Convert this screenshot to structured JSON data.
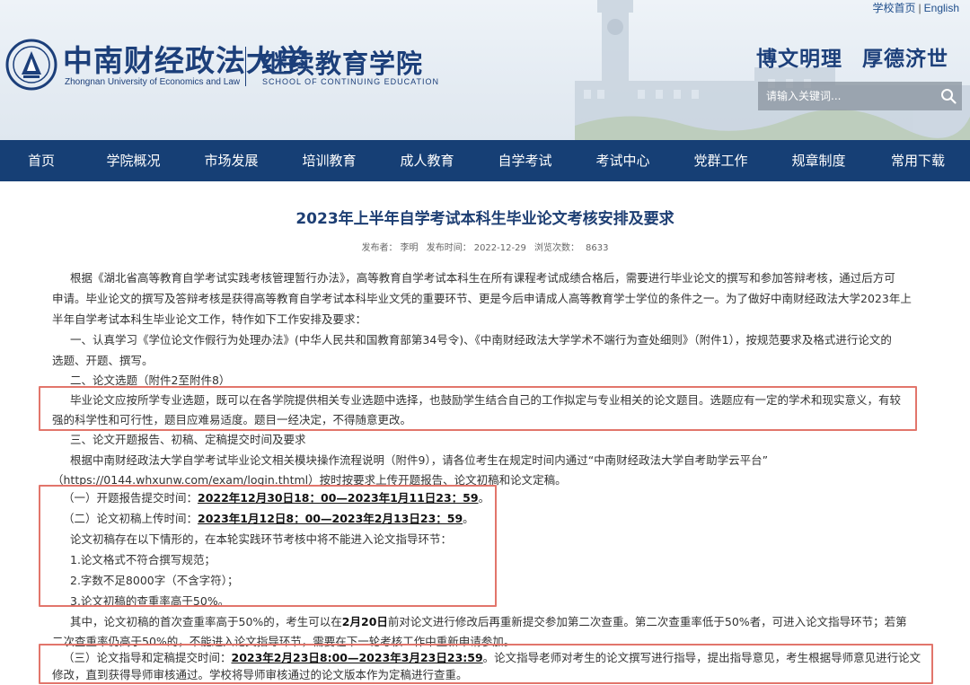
{
  "header": {
    "top_links": {
      "home": "学校首页",
      "separator": "|",
      "english": "English"
    },
    "university_cn": "中南财经政法大学",
    "university_en": "Zhongnan University of Economics and Law",
    "college_cn": "继续教育学院",
    "college_en": "SCHOOL OF CONTINUING EDUCATION",
    "motto_1": "博文明理",
    "motto_2": "厚德济世",
    "search": {
      "placeholder": "请输入关键词..."
    }
  },
  "nav": {
    "items": [
      {
        "label": "首页"
      },
      {
        "label": "学院概况"
      },
      {
        "label": "市场发展"
      },
      {
        "label": "培训教育"
      },
      {
        "label": "成人教育"
      },
      {
        "label": "自学考试"
      },
      {
        "label": "考试中心"
      },
      {
        "label": "党群工作"
      },
      {
        "label": "规章制度"
      },
      {
        "label": "常用下载"
      }
    ]
  },
  "article": {
    "title": "2023年上半年自学考试本科生毕业论文考核安排及要求",
    "meta": {
      "publisher_label": "发布者：",
      "publisher": "李明",
      "time_label": "发布时间：",
      "time": "2022-12-29",
      "views_label": "浏览次数：",
      "views": "8633"
    },
    "lines": {
      "p1_l1": "根据《湖北省高等教育自学考试实践考核管理暂行办法》，高等教育自学考试本科生在所有课程考试成绩合格后，需要进行毕业论文的撰写和参加答辩考核，通过后方可",
      "p1_l2": "申请。毕业论文的撰写及答辩考核是获得高等教育自学考试本科毕业文凭的重要环节、更是今后申请成人高等教育学士学位的条件之一。为了做好中南财经政法大学2023年上",
      "p1_l3": "半年自学考试本科生毕业论文工作，特作如下工作安排及要求：",
      "s1_l1": "一、认真学习《学位论文作假行为处理办法》(中华人民共和国教育部第34号令)、《中南财经政法大学学术不端行为查处细则》（附件1），按规范要求及格式进行论文的",
      "s1_l2": "选题、开题、撰写。",
      "s2_head": "二、论文选题（附件2至附件8）",
      "s2_l1": "毕业论文应按所学专业选题，既可以在各学院提供相关专业选题中选择，也鼓励学生结合自己的工作拟定与专业相关的论文题目。选题应有一定的学术和现实意义，有较",
      "s2_l2": "强的科学性和可行性，题目应难易适度。题目一经决定，不得随意更改。",
      "s3_head": "三、论文开题报告、初稿、定稿提交时间及要求",
      "s3_l1": "根据中南财经政法大学自学考试毕业论文相关模块操作流程说明（附件9），请各位考生在规定时间内通过“中南财经政法大学自考助学云平台”",
      "s3_l2": "（https://0144.whxunw.com/exam/login.thtml）按时按要求上传开题报告、论文初稿和论文定稿。",
      "i1_label": "（一）开题报告提交时间：",
      "i1_time": "2022年12月30日18：00—2023年1月11日23：59",
      "i1_end": "。",
      "i2_label": "（二）论文初稿上传时间：",
      "i2_time": "2023年1月12日8：00—2023年2月13日23：59",
      "i2_end": "。",
      "i2_note": "论文初稿存在以下情形的，在本轮实践环节考核中将不能进入论文指导环节：",
      "c1": "1.论文格式不符合撰写规范；",
      "c2": "2.字数不足8000字（不含字符）；",
      "c3": "3.论文初稿的查重率高于50%。",
      "p2_l1_a": "其中，论文初稿的首次查重率高于50%的，考生可以在",
      "p2_l1_b": "2月20日",
      "p2_l1_c": "前对论文进行修改后再重新提交参加第二次查重。第二次查重率低于50%者，可进入论文指导环节；若第",
      "p2_l2": "二次查重率仍高于50%的，不能进入论文指导环节，需要在下一轮考核工作中重新申请参加。",
      "i3_label": "（三）论文指导和定稿提交时间：",
      "i3_time": "2023年2月23日8:00—2023年3月23日23:59",
      "i3_rest": "。论文指导老师对考生的论文撰写进行指导，提出指导意见，考生根据导师意见进行论文",
      "i3_l2": "修改，直到获得导师审核通过。学校将导师审核通过的论文版本作为定稿进行查重。"
    }
  }
}
